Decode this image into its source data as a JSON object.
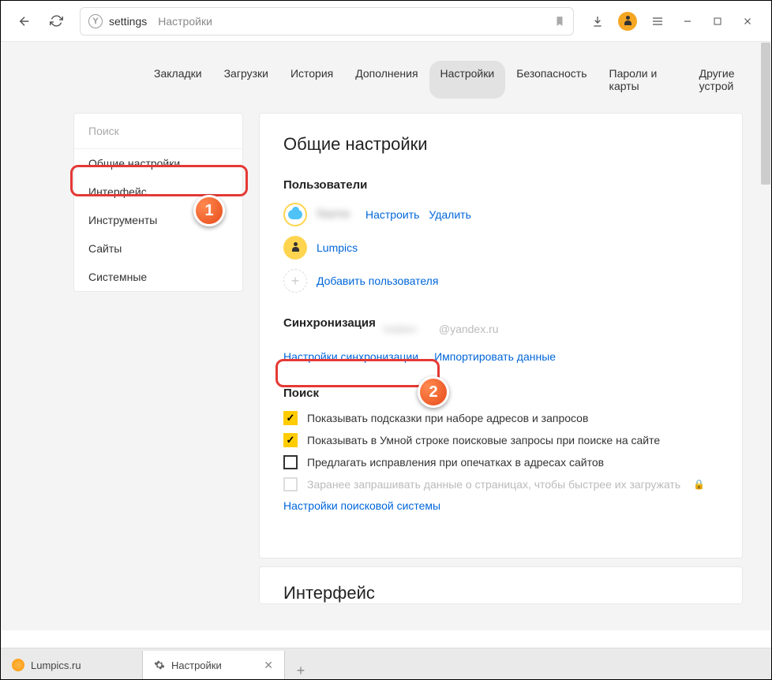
{
  "toolbar": {
    "address_page": "settings",
    "address_title": "Настройки"
  },
  "tabs": {
    "items": [
      "Закладки",
      "Загрузки",
      "История",
      "Дополнения",
      "Настройки",
      "Безопасность",
      "Пароли и карты",
      "Другие устрой"
    ],
    "active_index": 4
  },
  "sidebar": {
    "search_placeholder": "Поиск",
    "items": [
      "Общие настройки",
      "Интерфейс",
      "Инструменты",
      "Сайты",
      "Системные"
    ]
  },
  "panel": {
    "title": "Общие настройки",
    "users_heading": "Пользователи",
    "user1_name": "Name",
    "user1_configure": "Настроить",
    "user1_delete": "Удалить",
    "user2_name": "Lumpics",
    "add_user": "Добавить пользователя",
    "sync_heading": "Синхронизация",
    "sync_email_hidden": "hidden",
    "sync_email_domain": "@yandex.ru",
    "sync_settings_link": "Настройки синхронизации",
    "import_data_link": "Импортировать данные",
    "search_heading": "Поиск",
    "cb1": "Показывать подсказки при наборе адресов и запросов",
    "cb2": "Показывать в Умной строке поисковые запросы при поиске на сайте",
    "cb3": "Предлагать исправления при опечатках в адресах сайтов",
    "cb4": "Заранее запрашивать данные о страницах, чтобы быстрее их загружать",
    "search_engine_link": "Настройки поисковой системы",
    "next_panel_title": "Интерфейс"
  },
  "callouts": {
    "one": "1",
    "two": "2"
  },
  "bottom_tabs": {
    "tab1": "Lumpics.ru",
    "tab2": "Настройки"
  }
}
